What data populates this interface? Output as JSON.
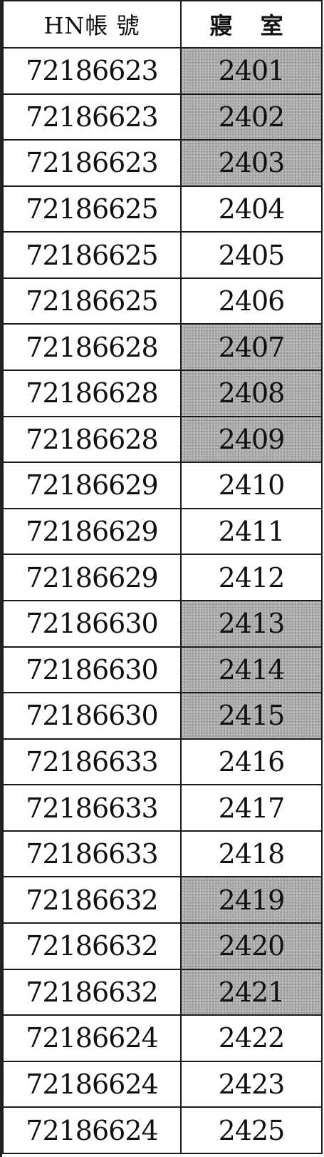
{
  "table": {
    "headers": {
      "hn": "HN帳 號",
      "room": "寢 室"
    },
    "rows": [
      {
        "hn": "72186623",
        "room": "2401",
        "shaded": true
      },
      {
        "hn": "72186623",
        "room": "2402",
        "shaded": true
      },
      {
        "hn": "72186623",
        "room": "2403",
        "shaded": true
      },
      {
        "hn": "72186625",
        "room": "2404",
        "shaded": false
      },
      {
        "hn": "72186625",
        "room": "2405",
        "shaded": false
      },
      {
        "hn": "72186625",
        "room": "2406",
        "shaded": false
      },
      {
        "hn": "72186628",
        "room": "2407",
        "shaded": true
      },
      {
        "hn": "72186628",
        "room": "2408",
        "shaded": true
      },
      {
        "hn": "72186628",
        "room": "2409",
        "shaded": true
      },
      {
        "hn": "72186629",
        "room": "2410",
        "shaded": false
      },
      {
        "hn": "72186629",
        "room": "2411",
        "shaded": false
      },
      {
        "hn": "72186629",
        "room": "2412",
        "shaded": false
      },
      {
        "hn": "72186630",
        "room": "2413",
        "shaded": true
      },
      {
        "hn": "72186630",
        "room": "2414",
        "shaded": true
      },
      {
        "hn": "72186630",
        "room": "2415",
        "shaded": true
      },
      {
        "hn": "72186633",
        "room": "2416",
        "shaded": false
      },
      {
        "hn": "72186633",
        "room": "2417",
        "shaded": false
      },
      {
        "hn": "72186633",
        "room": "2418",
        "shaded": false
      },
      {
        "hn": "72186632",
        "room": "2419",
        "shaded": true
      },
      {
        "hn": "72186632",
        "room": "2420",
        "shaded": true
      },
      {
        "hn": "72186632",
        "room": "2421",
        "shaded": true
      },
      {
        "hn": "72186624",
        "room": "2422",
        "shaded": false
      },
      {
        "hn": "72186624",
        "room": "2423",
        "shaded": false
      },
      {
        "hn": "72186624",
        "room": "2425",
        "shaded": false
      }
    ]
  },
  "colors": {
    "shade": "#a9a9a9",
    "border": "#1a1a1a",
    "text": "#111111"
  }
}
